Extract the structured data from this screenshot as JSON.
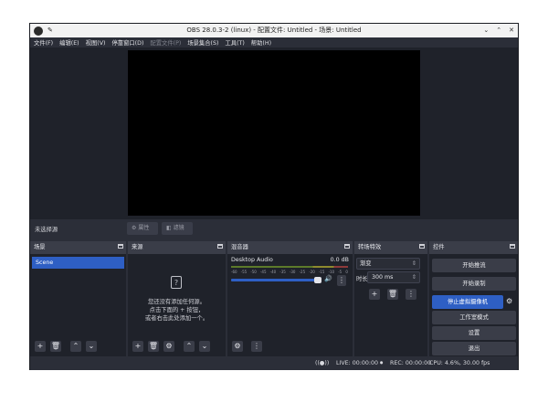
{
  "window": {
    "title": "OBS 28.0.3-2 (linux) - 配置文件: Untitled - 场景: Untitled"
  },
  "menu": [
    "文件(F)",
    "编辑(E)",
    "视图(V)",
    "停靠窗口(D)",
    "配置文件(P)",
    "场景集合(S)",
    "工具(T)",
    "帮助(H)"
  ],
  "source_bar": {
    "label": "未选择源",
    "properties": "属性",
    "filters": "滤镜"
  },
  "docks": {
    "scenes": {
      "title": "场景",
      "items": [
        "Scene"
      ]
    },
    "sources": {
      "title": "来源",
      "empty_lines": [
        "您还没有添加任何源。",
        "点击下面的 + 按钮，",
        "或者右击此处添加一个。"
      ]
    },
    "mixer": {
      "title": "混音器",
      "track": "Desktop Audio",
      "db": "0.0 dB",
      "scale": [
        "-60",
        "-55",
        "-50",
        "-45",
        "-40",
        "-35",
        "-30",
        "-25",
        "-20",
        "-15",
        "-10",
        "-5",
        "0"
      ],
      "volume": 1.0
    },
    "transitions": {
      "title": "转场特效",
      "type": "渐变",
      "duration_label": "时长",
      "duration": "300 ms"
    },
    "controls": {
      "title": "控件",
      "buttons": [
        "开始推流",
        "开始录制",
        "停止虚拟摄像机",
        "工作室模式",
        "设置",
        "退出"
      ]
    }
  },
  "status": {
    "live": "LIVE: 00:00:00",
    "rec": "REC: 00:00:00",
    "cpu": "CPU: 4.6%, 30.00 fps"
  },
  "colors": {
    "accent": "#2e5fc4",
    "panel": "#272a33",
    "window": "#2b2e38"
  }
}
